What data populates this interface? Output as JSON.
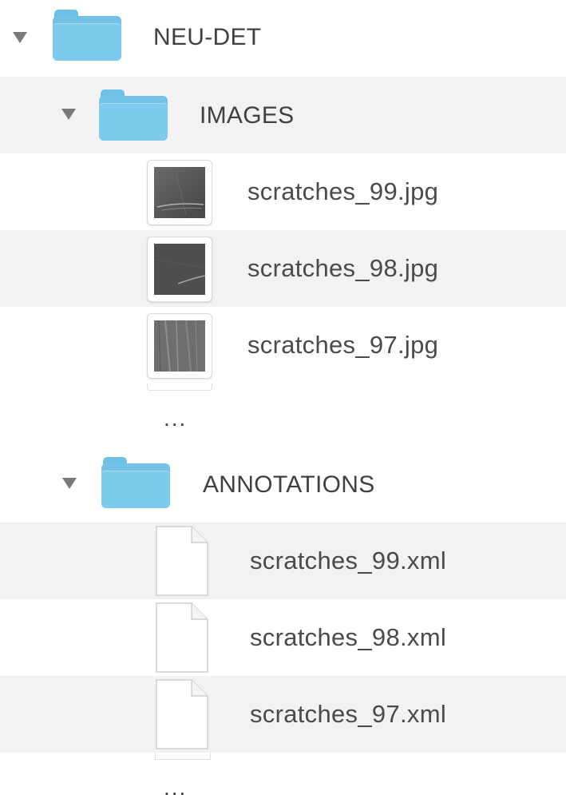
{
  "tree": {
    "root": {
      "name": "NEU-DET",
      "expanded": true,
      "icon": "folder-icon",
      "color": "#74c3e6"
    },
    "images": {
      "name": "IMAGES",
      "expanded": true,
      "icon": "folder-icon",
      "files": [
        {
          "name": "scratches_99.jpg",
          "icon": "image-thumbnail-icon"
        },
        {
          "name": "scratches_98.jpg",
          "icon": "image-thumbnail-icon"
        },
        {
          "name": "scratches_97.jpg",
          "icon": "image-thumbnail-icon"
        }
      ],
      "more": "..."
    },
    "annotations": {
      "name": "ANNOTATIONS",
      "expanded": true,
      "icon": "folder-icon",
      "files": [
        {
          "name": "scratches_99.xml",
          "icon": "document-icon"
        },
        {
          "name": "scratches_98.xml",
          "icon": "document-icon"
        },
        {
          "name": "scratches_97.xml",
          "icon": "document-icon"
        }
      ],
      "more": "..."
    }
  }
}
